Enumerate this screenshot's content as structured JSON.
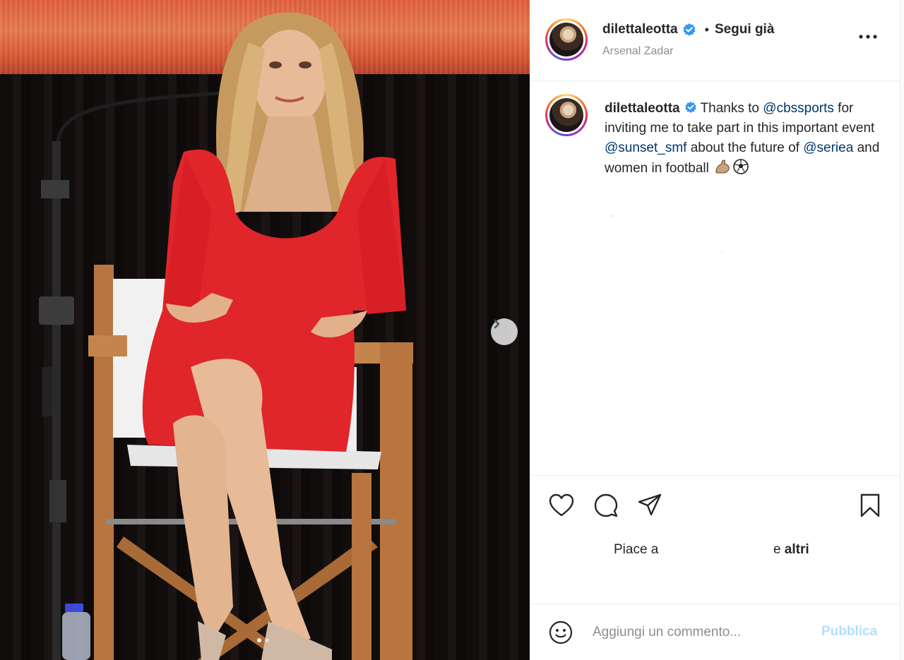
{
  "post": {
    "username": "dilettaleotta",
    "separator": "•",
    "follow_status": "Segui già",
    "location": "Arsenal Zadar",
    "caption": {
      "username": "dilettaleotta",
      "t1": "Thanks to",
      "m1": "@cbssports",
      "t2": "for inviting me to take part in this important event",
      "m2": "@sunset_smf",
      "t3": "about the future of",
      "m3": "@seriea",
      "t4": "and women in football"
    },
    "likes": {
      "prefix": "Piace a",
      "suffix_and": "e",
      "suffix_others": "altri"
    },
    "comment": {
      "placeholder": "Aggiungi un commento...",
      "publish_label": "Pubblica"
    },
    "carousel": {
      "slide_count": 2,
      "active_slide": 1
    }
  },
  "colors": {
    "verified": "#3897f0",
    "mention": "#00376b",
    "publish_disabled": "#b2dffc",
    "dress": "#e0262b"
  },
  "icons": [
    "verified-badge-icon",
    "more-options-icon",
    "chevron-right-icon",
    "heart-icon",
    "comment-icon",
    "share-icon",
    "bookmark-icon",
    "smiley-icon",
    "flexed-biceps-emoji",
    "soccer-ball-emoji"
  ]
}
